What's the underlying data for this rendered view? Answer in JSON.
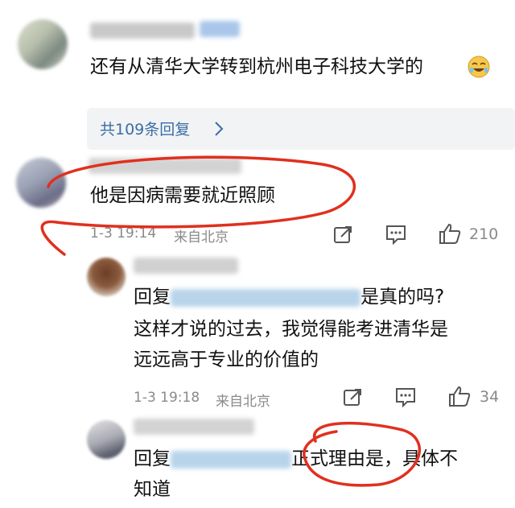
{
  "top_comment": {
    "text": "还有从清华大学转到杭州电子科技大学的",
    "replies_link": "共109条回复",
    "chevron": "chevron-right-icon"
  },
  "comment": {
    "text": "他是因病需要就近照顾",
    "time": "1-3 19:14",
    "location": "来自北京",
    "likes": "210"
  },
  "reply1": {
    "prefix": "回复",
    "line1_tail": "是真的吗?",
    "line2": "这样才说的过去，我觉得能考进清华是",
    "line3": "远远高于专业的价值的",
    "time": "1-3 19:18",
    "location": "来自北京",
    "likes": "34"
  },
  "reply2": {
    "prefix": "回复",
    "line1_mid": "正式理由是，具体不",
    "line2": "知道"
  },
  "colors": {
    "annotation_red": "#e0301e",
    "meta_gray": "#8a8a8a",
    "link_blue": "#3b6ea5"
  }
}
